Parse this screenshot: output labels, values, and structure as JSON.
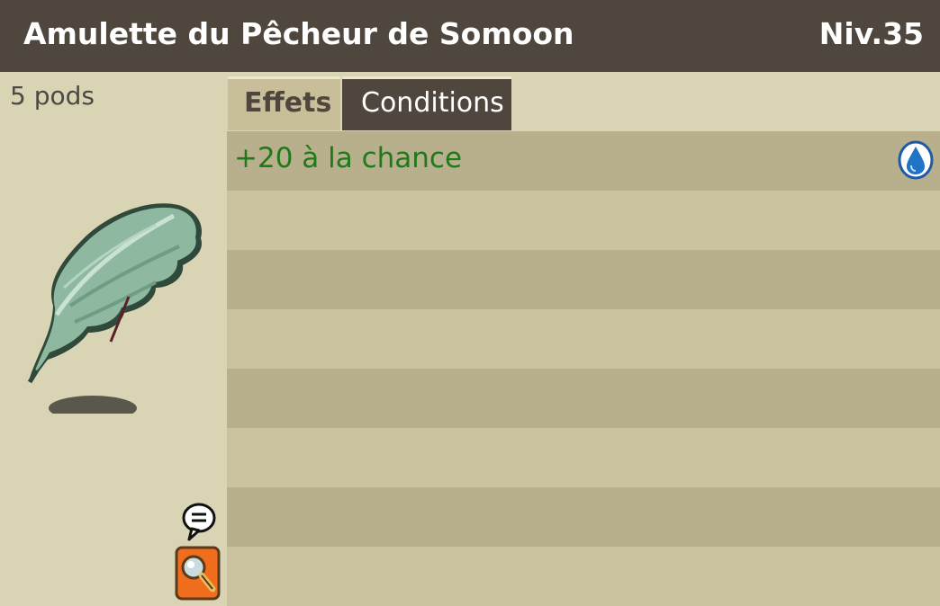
{
  "item": {
    "name": "Amulette du Pêcheur de Somoon",
    "level": "Niv.35",
    "weight": "5 pods"
  },
  "tabs": [
    {
      "label": "Effets",
      "active": true
    },
    {
      "label": "Conditions",
      "active": false
    }
  ],
  "effects": [
    {
      "text": "+20 à la chance",
      "icon": "water-drop-icon",
      "color": "#1f7a1b"
    }
  ],
  "icons": {
    "item": "feather-amulet-icon",
    "chat": "chat-bubble-icon",
    "zoom": "magnifier-icon"
  },
  "colors": {
    "header_bg": "#4f473d",
    "panel_bg": "#d9d4b4",
    "row_dark": "#b8af8d",
    "row_light": "#cbc3a0",
    "effect_text": "#1f7a1b",
    "zoom_button": "#f06d1d"
  }
}
